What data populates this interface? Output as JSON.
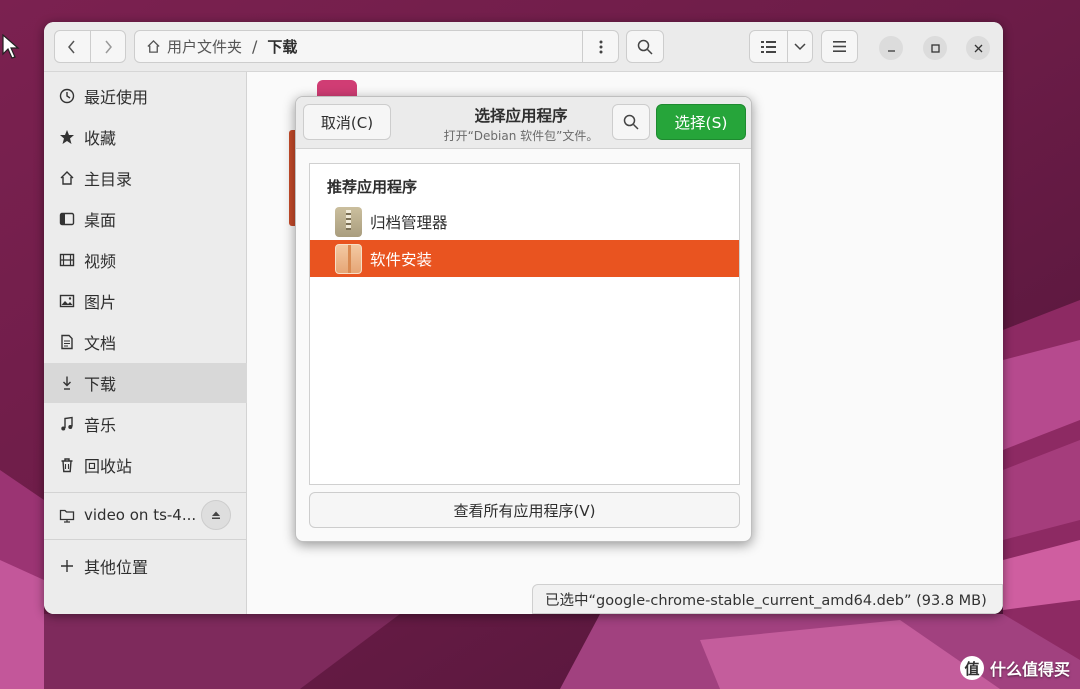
{
  "pathbar": {
    "home_label": "用户文件夹",
    "separator": "/",
    "current": "下载"
  },
  "sidebar": {
    "items": [
      {
        "label": "最近使用",
        "icon": "clock-icon"
      },
      {
        "label": "收藏",
        "icon": "star-icon"
      },
      {
        "label": "主目录",
        "icon": "home-icon"
      },
      {
        "label": "桌面",
        "icon": "desktop-icon"
      },
      {
        "label": "视频",
        "icon": "video-icon"
      },
      {
        "label": "图片",
        "icon": "image-icon"
      },
      {
        "label": "文档",
        "icon": "document-icon"
      },
      {
        "label": "下载",
        "icon": "download-icon"
      },
      {
        "label": "音乐",
        "icon": "music-icon"
      },
      {
        "label": "回收站",
        "icon": "trash-icon"
      }
    ],
    "network_drive": "video on ts-4...",
    "other_locations": "其他位置"
  },
  "status_text": "已选中“google-chrome-stable_current_amd64.deb” (93.8 MB)",
  "dialog": {
    "cancel_label": "取消(C)",
    "title": "选择应用程序",
    "subtitle": "打开“Debian 软件包”文件。",
    "select_label": "选择(S)",
    "list_heading": "推荐应用程序",
    "apps": [
      {
        "label": "归档管理器",
        "icon": "archive-manager-icon",
        "selected": false
      },
      {
        "label": "软件安装",
        "icon": "software-install-icon",
        "selected": true
      }
    ],
    "view_all_label": "查看所有应用程序(V)"
  },
  "watermark": {
    "logo": "值",
    "text": "什么值得买"
  },
  "colors": {
    "accent": "#e95420",
    "suggested": "#26a53a"
  }
}
